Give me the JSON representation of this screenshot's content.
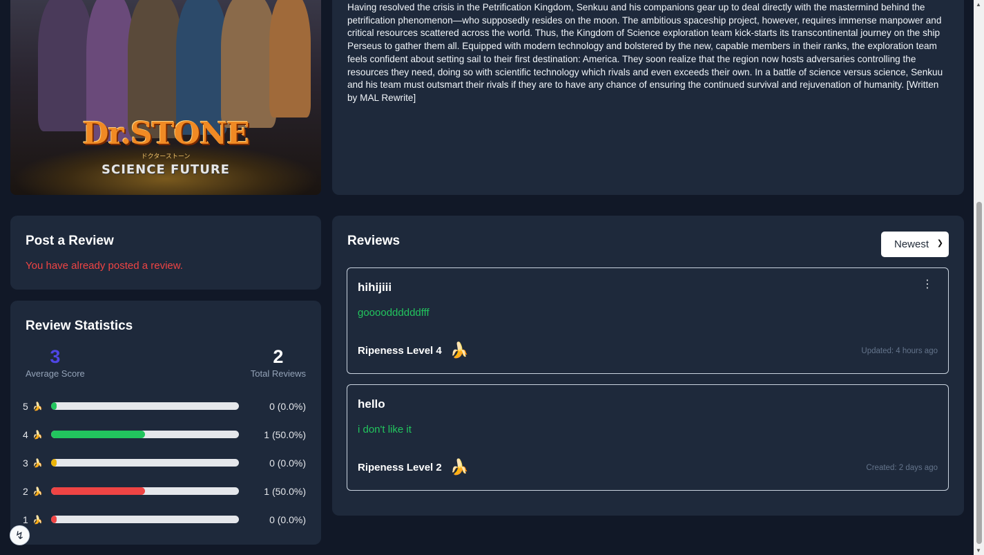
{
  "poster": {
    "logo": "Dr.STONE",
    "japanese": "ドクターストーン",
    "subtitle": "SCIENCE FUTURE"
  },
  "synopsis": {
    "text": "Having resolved the crisis in the Petrification Kingdom, Senkuu and his companions gear up to deal directly with the mastermind behind the petrification phenomenon—who supposedly resides on the moon. The ambitious spaceship project, however, requires immense manpower and critical resources scattered across the world. Thus, the Kingdom of Science exploration team kick-starts its transcontinental journey on the ship Perseus to gather them all. Equipped with modern technology and bolstered by the new, capable members in their ranks, the exploration team feels confident about setting sail to their first destination: America. They soon realize that the region now hosts adversaries controlling the resources they need, doing so with scientific technology which rivals and even exceeds their own. In a battle of science versus science, Senkuu and his team must outsmart their rivals if they are to have any chance of ensuring the continued survival and rejuvenation of humanity. [Written by MAL Rewrite]"
  },
  "post_review": {
    "title": "Post a Review",
    "message": "You have already posted a review."
  },
  "stats": {
    "title": "Review Statistics",
    "average_score": "3",
    "average_label": "Average Score",
    "total_reviews": "2",
    "total_label": "Total Reviews",
    "levels": [
      {
        "level": "5",
        "fraction": 0.0,
        "count": "0 (0.0%)",
        "color": "#22c55e",
        "icon": "banana-icon"
      },
      {
        "level": "4",
        "fraction": 0.5,
        "count": "1 (50.0%)",
        "color": "#22c55e",
        "icon": "banana-icon"
      },
      {
        "level": "3",
        "fraction": 0.0,
        "count": "0 (0.0%)",
        "color": "#eab308",
        "icon": "banana-icon"
      },
      {
        "level": "2",
        "fraction": 0.5,
        "count": "1 (50.0%)",
        "color": "#ef4444",
        "icon": "banana-icon"
      },
      {
        "level": "1",
        "fraction": 0.0,
        "count": "0 (0.0%)",
        "color": "#ef4444",
        "icon": "banana-icon"
      }
    ]
  },
  "reviews": {
    "title": "Reviews",
    "sort_value": "Newest",
    "items": [
      {
        "user": "hihijiii",
        "body": "gooooddddddfff",
        "ripeness": "Ripeness Level 4",
        "time": "Updated: 4 hours ago",
        "has_menu": true
      },
      {
        "user": "hello",
        "body": "i don't like it",
        "ripeness": "Ripeness Level 2",
        "time": "Created: 2 days ago",
        "has_menu": false
      }
    ]
  },
  "colors": {
    "accent": "#4f46e5",
    "error": "#ef4444",
    "success": "#22c55e",
    "card": "#1e293b",
    "background": "#111827"
  }
}
